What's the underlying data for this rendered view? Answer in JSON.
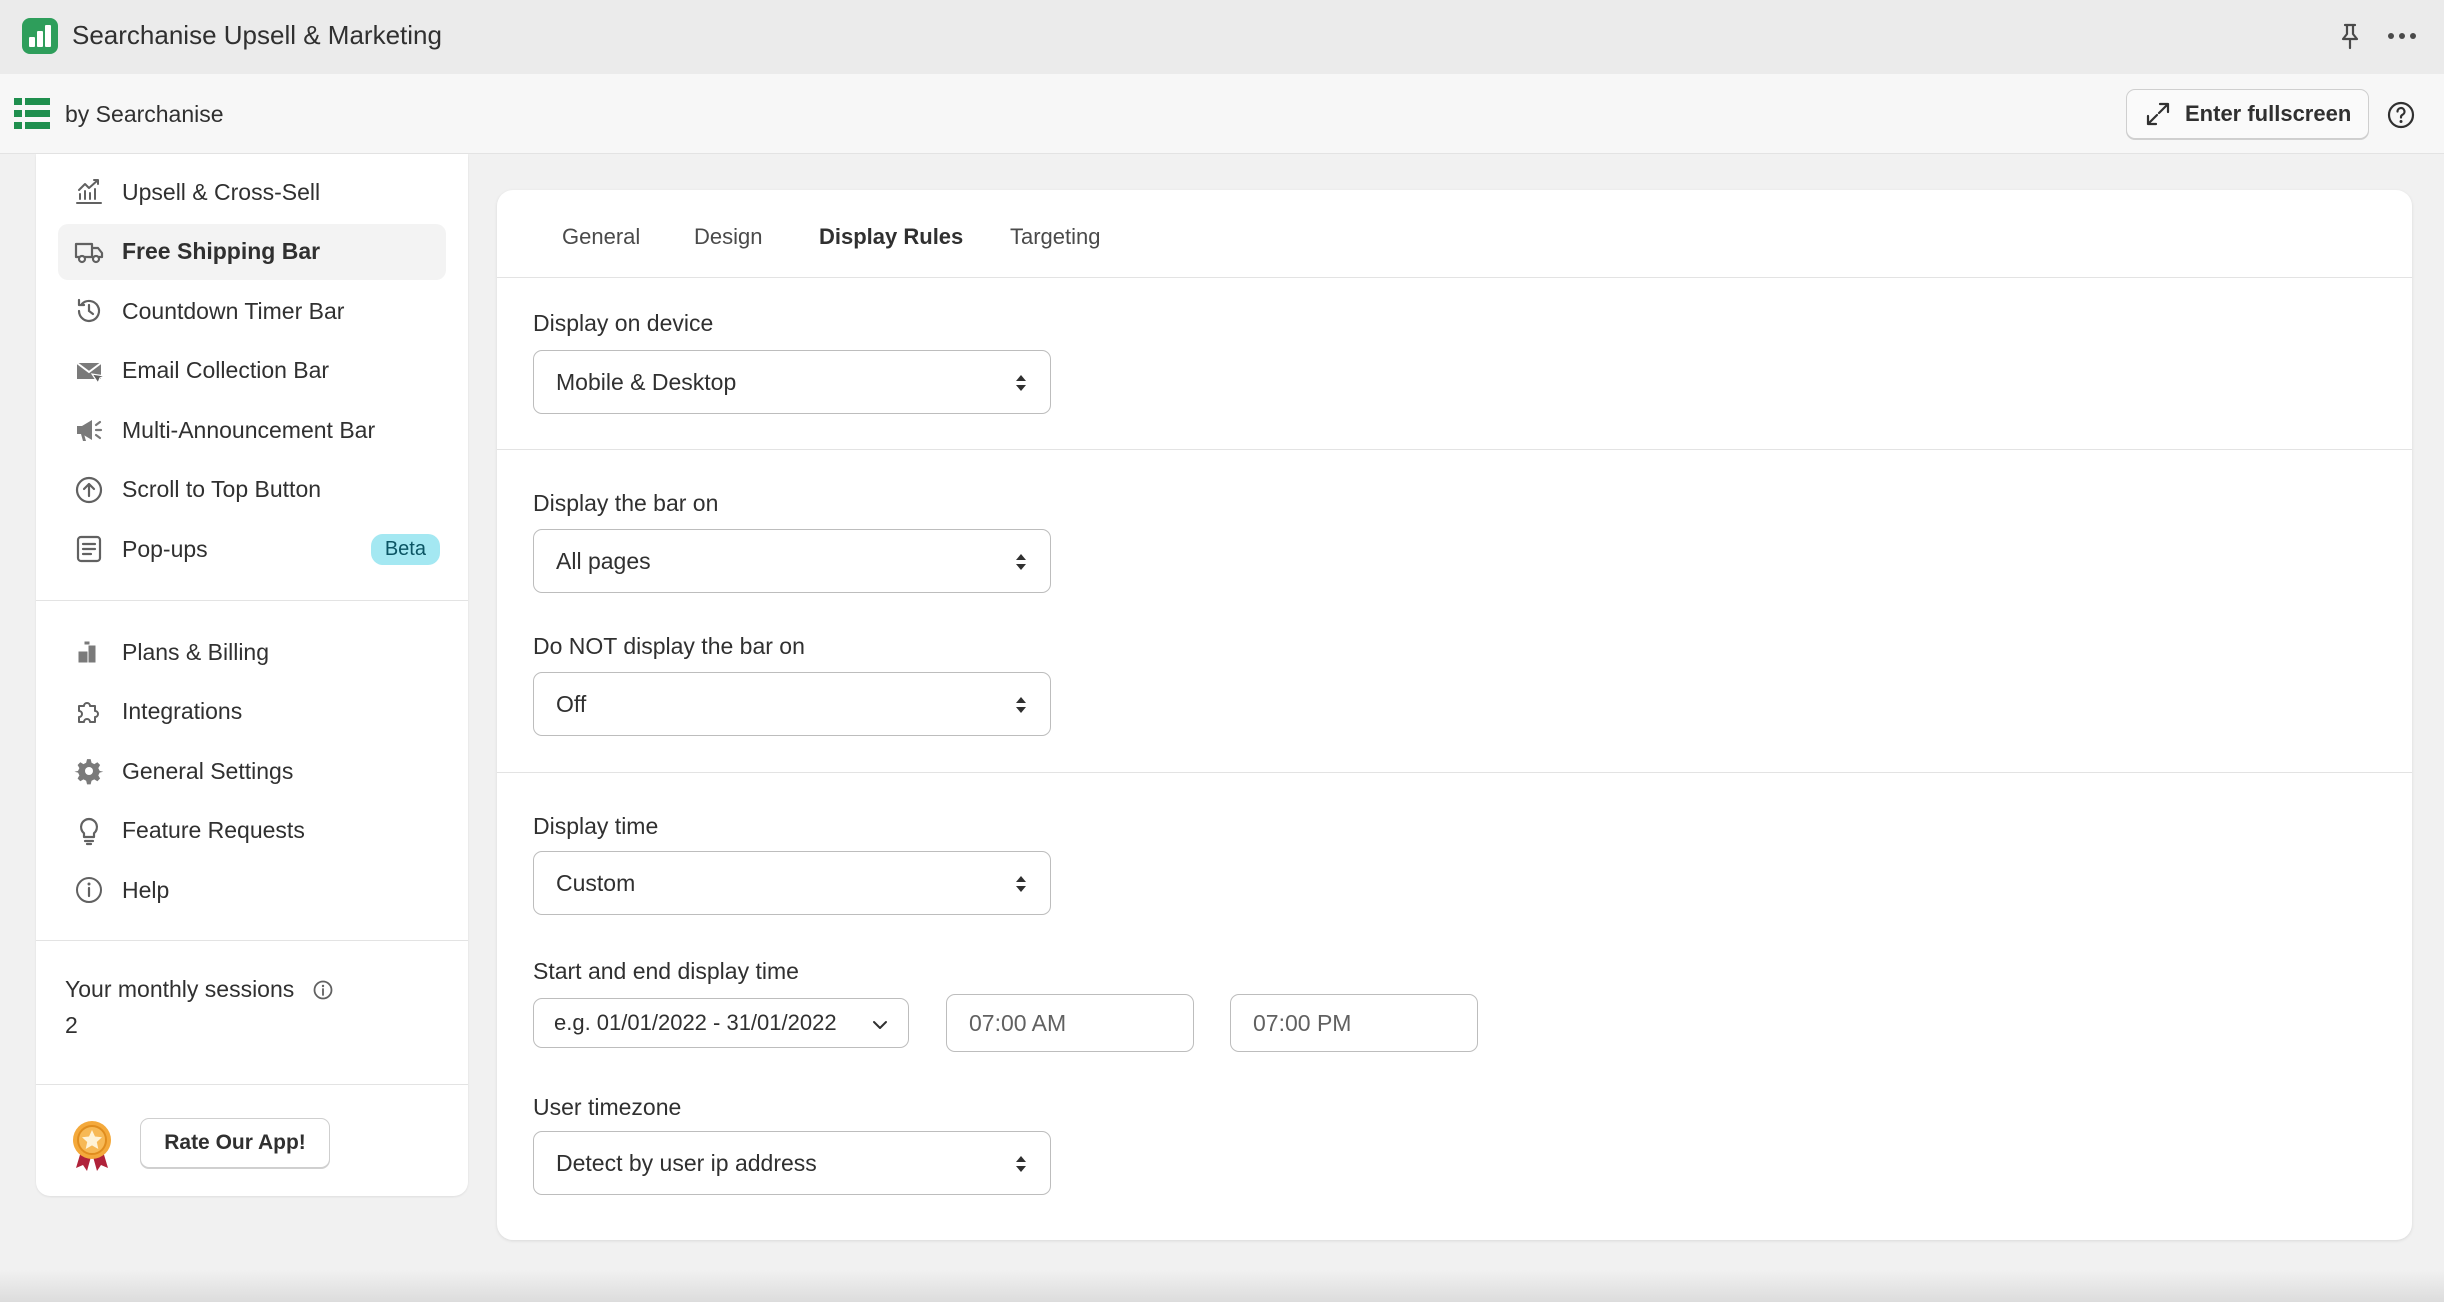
{
  "window": {
    "app_title": "Searchanise Upsell & Marketing",
    "by_text": "by Searchanise",
    "fullscreen_label": "Enter fullscreen"
  },
  "sidebar": {
    "items": [
      {
        "label": "Upsell & Cross-Sell",
        "icon": "chart-growth-icon"
      },
      {
        "label": "Free Shipping Bar",
        "icon": "truck-icon",
        "active": true
      },
      {
        "label": "Countdown Timer Bar",
        "icon": "clock-history-icon"
      },
      {
        "label": "Email Collection Bar",
        "icon": "envelope-icon"
      },
      {
        "label": "Multi-Announcement Bar",
        "icon": "megaphone-icon"
      },
      {
        "label": "Scroll to Top Button",
        "icon": "arrow-up-circle-icon"
      },
      {
        "label": "Pop-ups",
        "icon": "popup-window-icon",
        "badge": "Beta"
      }
    ],
    "settings_items": [
      {
        "label": "Plans & Billing",
        "icon": "billing-icon"
      },
      {
        "label": "Integrations",
        "icon": "puzzle-icon"
      },
      {
        "label": "General Settings",
        "icon": "gear-icon"
      },
      {
        "label": "Feature Requests",
        "icon": "lightbulb-icon"
      },
      {
        "label": "Help",
        "icon": "info-circle-icon"
      }
    ],
    "sessions_label": "Your monthly sessions",
    "sessions_value": "2",
    "rate_label": "Rate Our App!"
  },
  "tabs": [
    {
      "label": "General"
    },
    {
      "label": "Design"
    },
    {
      "label": "Display Rules",
      "active": true
    },
    {
      "label": "Targeting"
    }
  ],
  "form": {
    "device_label": "Display on device",
    "device_value": "Mobile & Desktop",
    "bar_on_label": "Display the bar on",
    "bar_on_value": "All pages",
    "not_display_label": "Do NOT display the bar on",
    "not_display_value": "Off",
    "time_label": "Display time",
    "time_value": "Custom",
    "start_end_label": "Start and end display time",
    "date_placeholder": "e.g. 01/01/2022 - 31/01/2022",
    "start_time_placeholder": "07:00 AM",
    "end_time_placeholder": "07:00 PM",
    "timezone_label": "User timezone",
    "timezone_value": "Detect by user ip address"
  },
  "colors": {
    "app_logo": "#2e9e5b",
    "beta_badge": "#a4e8f2",
    "active_item_bg": "#f3f3f3"
  }
}
